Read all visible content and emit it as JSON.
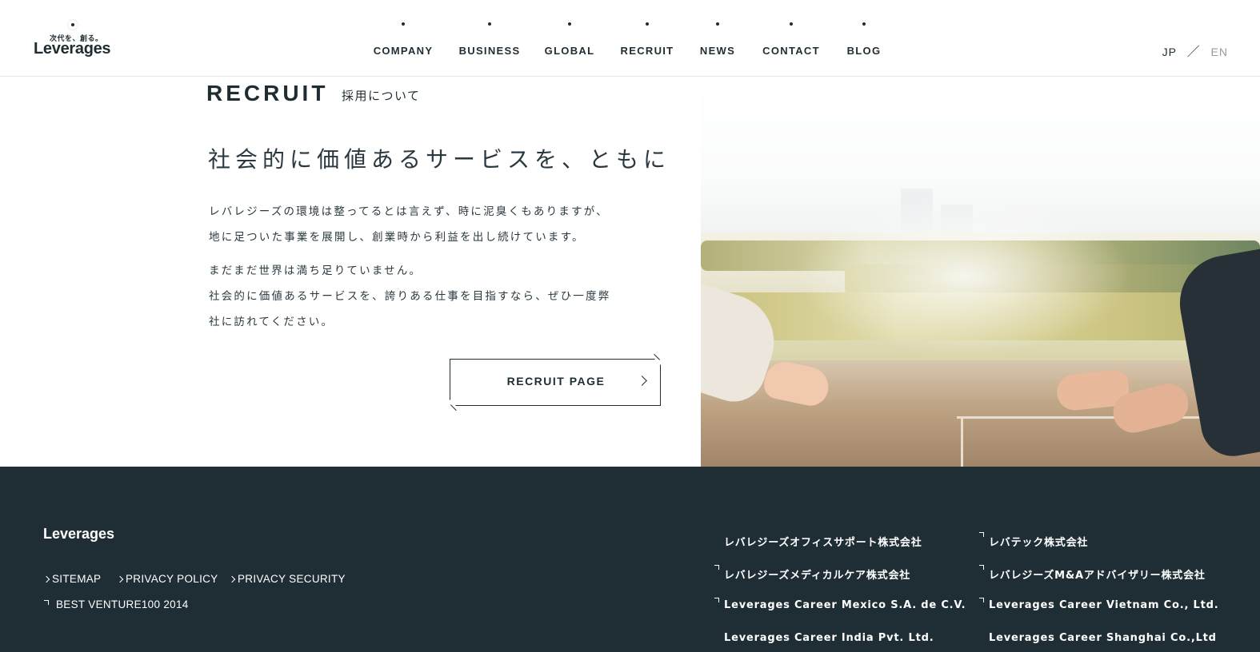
{
  "header": {
    "logo_tagline": "次代を、創る。",
    "logo_word": "Leverages",
    "nav": [
      {
        "label": "COMPANY"
      },
      {
        "label": "BUSINESS"
      },
      {
        "label": "GLOBAL"
      },
      {
        "label": "RECRUIT"
      },
      {
        "label": "NEWS"
      },
      {
        "label": "CONTACT"
      },
      {
        "label": "BLOG"
      }
    ],
    "lang": {
      "jp": "JP",
      "sep": "／",
      "en": "EN"
    }
  },
  "recruit": {
    "title": "RECRUIT",
    "subtitle": "採用について",
    "headline": "社会的に価値あるサービスを、ともに",
    "paragraph1": [
      "レバレジーズの環境は整ってるとは言えず、時に泥臭くもありますが、",
      "地に足ついた事業を展開し、創業時から利益を出し続けています。"
    ],
    "paragraph2": [
      "まだまだ世界は満ち足りていません。",
      "社会的に価値あるサービスを、誇りある仕事を目指すなら、ぜひ一度弊",
      "社に訪れてください。"
    ],
    "button_label": "RECRUIT PAGE"
  },
  "footer": {
    "logo": "Leverages",
    "links": {
      "sitemap": "SITEMAP",
      "privacy_policy": "PRIVACY POLICY",
      "privacy_security": "PRIVACY SECURITY",
      "best_venture": "BEST VENTURE100 2014"
    },
    "companies": [
      "レバレジーズオフィスサポート株式会社",
      "レバテック株式会社",
      "レバレジーズメディカルケア株式会社",
      "レバレジーズM&Aアドバイザリー株式会社",
      "Leverages Career Mexico S.A. de C.V.",
      "Leverages Career Vietnam Co., Ltd.",
      "Leverages Career India Pvt. Ltd.",
      "Leverages Career Shanghai Co.,Ltd"
    ]
  },
  "colors": {
    "text": "#1f2d33",
    "footer_bg": "#1f2e35",
    "lang_inactive": "#999999"
  }
}
